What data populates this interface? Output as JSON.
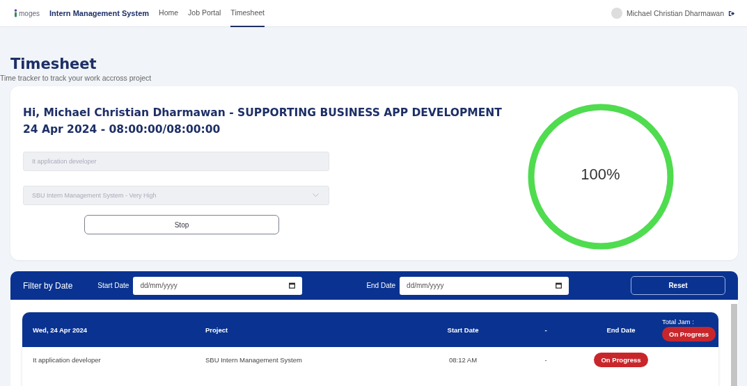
{
  "nav": {
    "brand": "moges",
    "app_title": "Intern Management System",
    "links": [
      {
        "label": "Home",
        "selected": false
      },
      {
        "label": "Job Portal",
        "selected": false
      },
      {
        "label": "Timesheet",
        "selected": true
      }
    ],
    "user": "Michael Christian Dharmawan"
  },
  "header": {
    "title": "Timesheet",
    "subtitle": "Time tracker to track your work accross project"
  },
  "tracker": {
    "greeting": "Hi, Michael Christian Dharmawan - SUPPORTING BUSINESS APP DEVELOPMENT",
    "date_time": "24 Apr 2024 - 08:00:00/08:00:00",
    "task_field": {
      "value": "It application developer",
      "disabled": true
    },
    "project_select": {
      "value": "SBU Intern Management System - Very High",
      "disabled": true
    },
    "button": "Stop",
    "progress": {
      "level": 1,
      "reading": "100%"
    }
  },
  "filter": {
    "title": "Filter by Date",
    "start_label": "Start Date",
    "start_placeholder": "dd/mm/yyyy",
    "end_label": "End Date",
    "end_placeholder": "dd/mm/yyyy",
    "reset": "Reset"
  },
  "table": {
    "columns": [
      "Wed, 24 Apr 2024",
      "Project",
      "Start Date",
      "-",
      "End Date"
    ],
    "total_label": "Total Jam :",
    "total_status": "On Progress",
    "rows": [
      {
        "cells": [
          "It application developer",
          "SBU Intern Management System",
          "08:12 AM",
          "-"
        ],
        "status": "On Progress"
      }
    ]
  }
}
